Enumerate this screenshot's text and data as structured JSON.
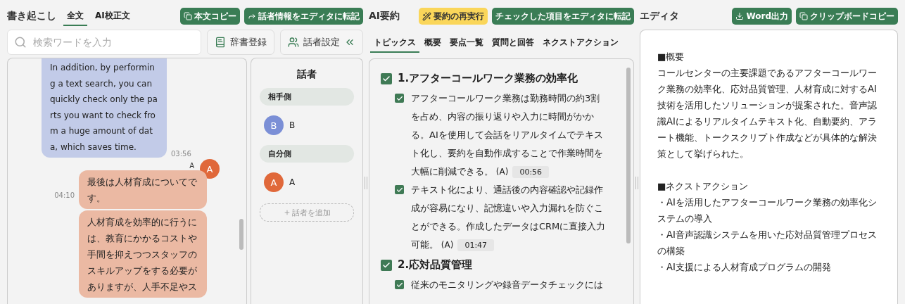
{
  "transcript": {
    "title": "書き起こし",
    "tabs": [
      {
        "label": "全文",
        "selected": true
      },
      {
        "label": "AI校正文",
        "selected": false
      }
    ],
    "buttons": [
      {
        "kind": "copy",
        "label": "本文コピー"
      },
      {
        "kind": "forward",
        "label": "話者情報をエディタに転記"
      }
    ],
    "search": {
      "placeholder": "検索ワードを入力"
    },
    "tools": [
      {
        "kind": "dictionary",
        "label": "辞書登録"
      },
      {
        "kind": "speakers",
        "label": "話者設定"
      }
    ],
    "messages": [
      {
        "kind": "other",
        "bubbles": [
          {
            "text": "In addition, by performing a text search, you can quickly check only the parts you want to check from a huge amount of data, which saves time.",
            "time": "03:56"
          }
        ]
      },
      {
        "kind": "self",
        "speaker": "A",
        "avatar": "A",
        "color": "#e0683a",
        "bubbles": [
          {
            "text": "最後は人材育成についてです。",
            "time": "04:10"
          },
          {
            "text": "人材育成を効率的に行うには、教育にかかるコストや手間を抑えつつスタッフのスキルアップをする必要がありますが、人手不足やス"
          }
        ]
      }
    ]
  },
  "speakers": {
    "title": "話者",
    "groups": [
      {
        "label": "相手側",
        "members": [
          {
            "avatar": "B",
            "name": "B",
            "color": "#7b8fd6"
          }
        ]
      },
      {
        "label": "自分側",
        "members": [
          {
            "avatar": "A",
            "name": "A",
            "color": "#e0683a"
          }
        ]
      }
    ],
    "add_button": "話者を追加"
  },
  "summary": {
    "title": "AI要約",
    "buttons": [
      {
        "kind": "rerun",
        "label": "要約の再実行"
      },
      {
        "kind": "transfer",
        "label": "チェックした項目をエディタに転記"
      }
    ],
    "tabs": [
      {
        "label": "トピックス",
        "selected": true
      },
      {
        "label": "概要",
        "selected": false
      },
      {
        "label": "要点一覧",
        "selected": false
      },
      {
        "label": "質問と回答",
        "selected": false
      },
      {
        "label": "ネクストアクション",
        "selected": false
      }
    ],
    "topics": [
      {
        "title": "1.アフターコールワーク業務の効率化",
        "checked": true,
        "items": [
          {
            "text": "アフターコールワーク業務は勤務時間の約3割を占め、内容の振り返りや入力に時間がかかる。AIを使用して会話をリアルタイムでテキスト化し、要約を自動作成することで作業時間を大幅に削減できる。",
            "speaker": "(A)",
            "time": "00:56",
            "checked": true
          },
          {
            "text": "テキスト化により、通話後の内容確認や記録作成が容易になり、記憶違いや入力漏れを防ぐことができる。作成したデータはCRMに直接入力可能。",
            "speaker": "(A)",
            "time": "01:47",
            "checked": true
          }
        ]
      },
      {
        "title": "2.応対品質管理",
        "checked": true,
        "items": [
          {
            "text": "従来のモニタリングや録音データチェックには",
            "checked": true
          }
        ]
      }
    ]
  },
  "editor": {
    "title": "エディタ",
    "buttons": [
      {
        "kind": "download",
        "label": "Word出力"
      },
      {
        "kind": "copy",
        "label": "クリップボードコピー"
      }
    ],
    "blocks": [
      {
        "lines": [
          "■概要",
          "コールセンターの主要課題であるアフターコールワーク業務の効率化、応対品質管理、人材育成に対するAI技術を活用したソリューションが提案された。音声認識AIによるリアルタイムテキスト化、自動要約、アラート機能、トークスクリプト作成などが具体的な解決策として挙げられた。"
        ]
      },
      {
        "lines": [
          "■ネクストアクション",
          "・AIを活用したアフターコールワーク業務の効率化システムの導入",
          "・AI音声認識システムを用いた応対品質管理プロセスの構築",
          "・AI支援による人材育成プログラムの開発"
        ]
      }
    ]
  }
}
